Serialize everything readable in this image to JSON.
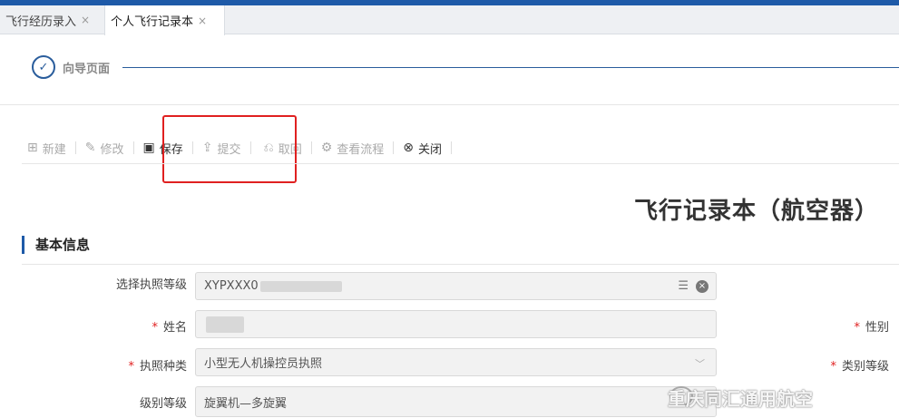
{
  "tabs": [
    {
      "label": "飞行经历录入",
      "close": "×"
    },
    {
      "label": "个人飞行记录本",
      "close": "×"
    }
  ],
  "wizard": {
    "step_label": "向导页面",
    "check_icon": "check-circle-icon"
  },
  "toolbar": {
    "new_label": "新建",
    "edit_label": "修改",
    "save_label": "保存",
    "submit_label": "提交",
    "withdraw_label": "取回",
    "flow_label": "查看流程",
    "close_label": "关闭"
  },
  "page_title": "飞行记录本（航空器）",
  "section": {
    "title": "基本信息"
  },
  "form": {
    "license_level_label": "选择执照等级",
    "license_level_value": "XYPXXX0",
    "name_label": "姓名",
    "gender_label": "性别",
    "license_type_label": "执照种类",
    "license_type_value": "小型无人机操控员执照",
    "category_label": "类别等级",
    "grade_label": "级别等级",
    "grade_value": "旋翼机—多旋翼"
  },
  "watermark": {
    "text": "重庆同汇通用航空"
  },
  "colors": {
    "accent": "#1e5aa8",
    "highlight_box": "#e02020",
    "required": "#e02020"
  }
}
